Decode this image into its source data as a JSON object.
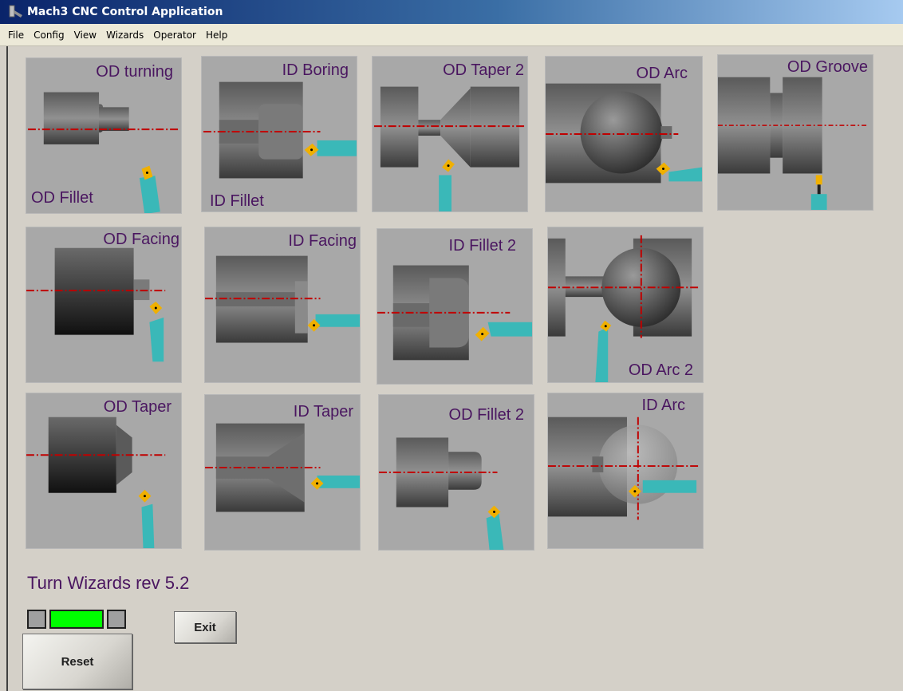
{
  "window": {
    "title": "Mach3 CNC Control Application"
  },
  "menu": [
    "File",
    "Config",
    "View",
    "Wizards",
    "Operator",
    "Help"
  ],
  "tiles": {
    "od_turning": {
      "label": "OD turning",
      "label2": "OD Fillet"
    },
    "id_boring": {
      "label": "ID Boring",
      "label2": "ID Fillet"
    },
    "od_taper2": {
      "label": "OD Taper 2"
    },
    "od_arc": {
      "label": "OD Arc"
    },
    "od_groove": {
      "label": "OD Groove"
    },
    "od_facing": {
      "label": "OD Facing"
    },
    "id_facing": {
      "label": "ID Facing"
    },
    "id_fillet2": {
      "label": "ID Fillet 2"
    },
    "od_arc2": {
      "label": "OD Arc 2"
    },
    "od_taper": {
      "label": "OD Taper"
    },
    "id_taper": {
      "label": "ID Taper"
    },
    "od_fillet2": {
      "label": "OD Fillet 2"
    },
    "id_arc": {
      "label": "ID Arc"
    }
  },
  "footer": {
    "revision": "Turn Wizards rev 5.2",
    "exit_label": "Exit",
    "reset_label": "Reset"
  },
  "colors": {
    "label": "#4a1660",
    "centerline": "#c00000",
    "tool_holder": "#3ab8b8",
    "insert": "#f0b000",
    "led_on": "#00ff00",
    "led_off": "#a0a0a0"
  }
}
